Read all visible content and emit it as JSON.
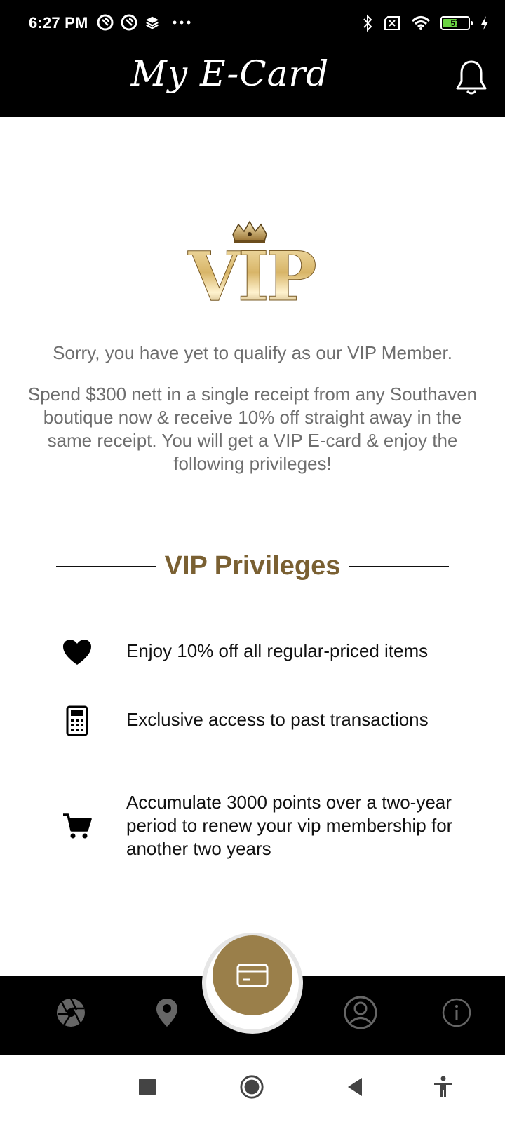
{
  "status_bar": {
    "time": "6:27 PM",
    "left_icons": [
      "notification-app-icon",
      "notification-app-icon",
      "layers-icon",
      "more-dots-icon"
    ],
    "right_icons": [
      "bluetooth-icon",
      "no-sim-icon",
      "wifi-icon",
      "battery-icon",
      "charging-icon"
    ],
    "battery_level": "57",
    "battery_fraction": 0.57
  },
  "header": {
    "title": "My E-Card",
    "bell_icon": "bell-icon"
  },
  "logo": {
    "text": "VIP",
    "crown_icon": "crown-icon"
  },
  "messages": {
    "sorry": "Sorry, you have yet to qualify as our VIP Member.",
    "spend": "Spend $300 nett in a single receipt from any Southaven boutique now & receive 10% off straight away in the same receipt. You will get a VIP E-card & enjoy the following privileges!"
  },
  "privileges": {
    "title": "VIP Privileges",
    "items": [
      {
        "icon": "heart-icon",
        "text": "Enjoy 10% off all regular-priced items"
      },
      {
        "icon": "calculator-icon",
        "text": "Exclusive access to past transactions"
      },
      {
        "icon": "cart-icon",
        "text": "Accumulate 3000 points over a two-year period to renew your vip membership for another two years"
      }
    ]
  },
  "bottom_nav": {
    "items": [
      "aperture-icon",
      "location-pin-icon",
      "card-icon",
      "profile-icon",
      "info-icon"
    ],
    "center_icon": "card-icon"
  },
  "system_nav": {
    "items": [
      "recents-square-icon",
      "home-circle-icon",
      "back-triangle-icon",
      "accessibility-icon"
    ]
  },
  "colors": {
    "bar_bg": "#000000",
    "gold": "#9a7f4a",
    "heading_gold": "#7a6032",
    "body_gray": "#6e6e6e",
    "battery_green": "#6bd443"
  }
}
